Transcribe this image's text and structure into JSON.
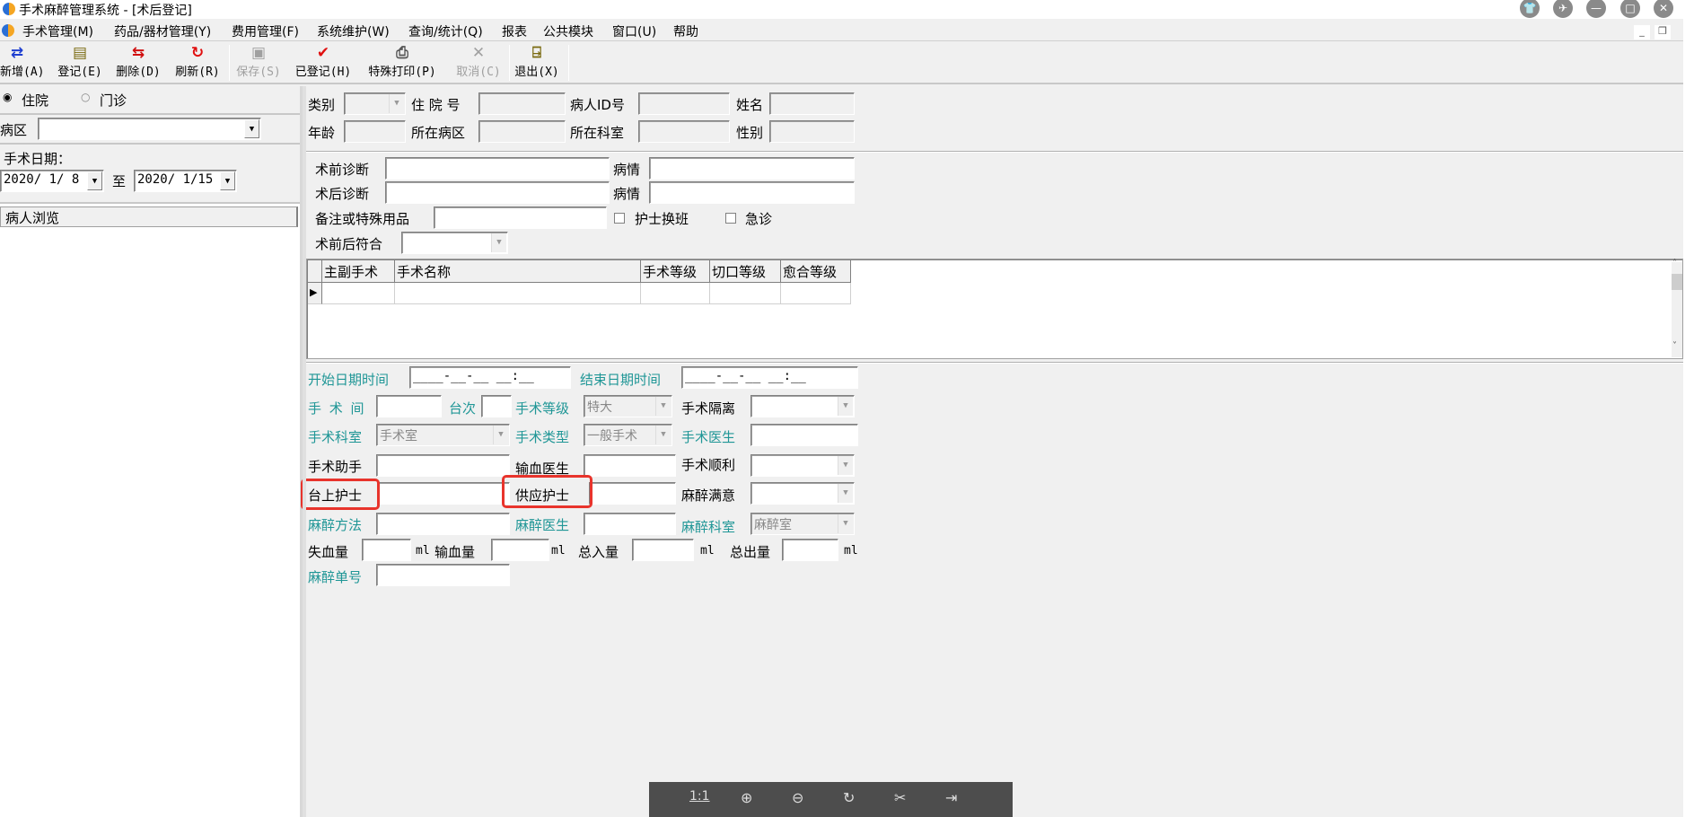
{
  "window": {
    "title": "手术麻醉管理系统 - [术后登记]"
  },
  "menu": [
    "手术管理(M)",
    "药品/器材管理(Y)",
    "费用管理(F)",
    "系统维护(W)",
    "查询/统计(Q)",
    "报表",
    "公共模块",
    "窗口(U)",
    "帮助"
  ],
  "toolbar": [
    {
      "label": "新增(A)",
      "icon": "add-icon",
      "enabled": true
    },
    {
      "label": "登记(E)",
      "icon": "register-icon",
      "enabled": true
    },
    {
      "label": "删除(D)",
      "icon": "delete-icon",
      "enabled": true
    },
    {
      "label": "刷新(R)",
      "icon": "refresh-icon",
      "enabled": true
    },
    {
      "label": "保存(S)",
      "icon": "save-icon",
      "enabled": false
    },
    {
      "label": "已登记(H)",
      "icon": "check-icon",
      "enabled": true
    },
    {
      "label": "特殊打印(P)",
      "icon": "printer-icon",
      "enabled": true
    },
    {
      "label": "取消(C)",
      "icon": "cancel-icon",
      "enabled": false
    },
    {
      "label": "退出(X)",
      "icon": "exit-icon",
      "enabled": true
    }
  ],
  "left": {
    "radio_inpatient": "住院",
    "radio_outpatient": "门诊",
    "selected": "住院",
    "ward_label": "病区",
    "ward_value": "",
    "date_label": "手术日期：",
    "date_from": "2020/ 1/ 8",
    "date_to_label": "至",
    "date_to": "2020/ 1/15",
    "browse_header": "病人浏览"
  },
  "patient": {
    "category": "类别",
    "admission_no": "住 院 号",
    "patient_id": "病人ID号",
    "name": "姓名",
    "age": "年龄",
    "ward": "所在病区",
    "dept": "所在科室",
    "sex": "性别"
  },
  "diag": {
    "pre_diag": "术前诊断",
    "pre_cond": "病情",
    "post_diag": "术后诊断",
    "post_cond": "病情",
    "notes": "备注或特殊用品",
    "nurse_shift": "护士换班",
    "emergency": "急诊",
    "match": "术前后符合"
  },
  "grid": {
    "columns": [
      "主副手术",
      "手术名称",
      "手术等级",
      "切口等级",
      "愈合等级"
    ]
  },
  "op": {
    "start": "开始日期时间",
    "start_value": "____-__-__ __:__",
    "end": "结束日期时间",
    "end_value": "____-__-__ __:__",
    "room": "手 术 间",
    "seq": "台次",
    "level": "手术等级",
    "level_value": "特大",
    "isolation": "手术隔离",
    "op_dept": "手术科室",
    "op_dept_value": "手术室",
    "op_type": "手术类型",
    "op_type_value": "一般手术",
    "surgeon": "手术医生",
    "assistant": "手术助手",
    "transfusion_doctor": "输血医生",
    "smooth": "手术顺利",
    "scrub_nurse": "台上护士",
    "supply_nurse": "供应护士",
    "anes_satisfaction": "麻醉满意",
    "anes_method": "麻醉方法",
    "anes_doctor": "麻醉医生",
    "anes_dept": "麻醉科室",
    "anes_dept_value": "麻醉室",
    "blood_loss": "失血量",
    "transfusion": "输血量",
    "total_in": "总入量",
    "total_out": "总出量",
    "unit": "ml",
    "anes_no": "麻醉单号"
  },
  "viewer": {
    "actual_size": "1:1"
  }
}
